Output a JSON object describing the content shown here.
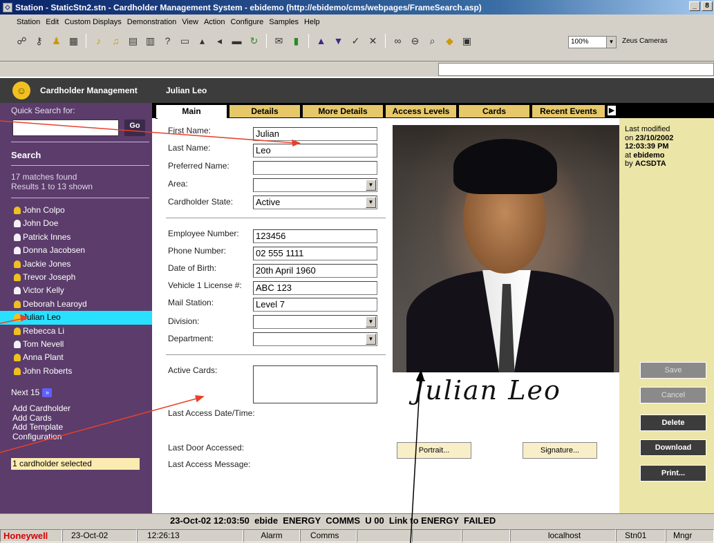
{
  "window": {
    "title": "Station - StaticStn2.stn - Cardholder Management System - ebidemo (http://ebidemo/cms/webpages/FrameSearch.asp)",
    "controls": [
      "_",
      "8",
      "×"
    ]
  },
  "menu": [
    "Station",
    "Edit",
    "Custom Displays",
    "Demonstration",
    "View",
    "Action",
    "Configure",
    "Samples",
    "Help"
  ],
  "toolbar": {
    "zoom": "100%",
    "camera": "Zeus Cameras"
  },
  "header": {
    "section": "Cardholder Management",
    "person": "Julian Leo"
  },
  "sidebar": {
    "quick_search_label": "Quick Search for:",
    "go_label": "Go",
    "search_heading": "Search",
    "matches": "17 matches found",
    "shown": "Results 1 to 13 shown",
    "results": [
      {
        "name": "John Colpo",
        "icon": "yellow"
      },
      {
        "name": "John Doe",
        "icon": "white"
      },
      {
        "name": "Patrick Innes",
        "icon": "white"
      },
      {
        "name": "Donna Jacobsen",
        "icon": "white"
      },
      {
        "name": "Jackie Jones",
        "icon": "yellow"
      },
      {
        "name": "Trevor Joseph",
        "icon": "yellow"
      },
      {
        "name": "Victor Kelly",
        "icon": "white"
      },
      {
        "name": "Deborah Learoyd",
        "icon": "yellow"
      },
      {
        "name": "Julian Leo",
        "icon": "yellow",
        "selected": true
      },
      {
        "name": "Rebecca Li",
        "icon": "yellow"
      },
      {
        "name": "Tom Nevell",
        "icon": "white"
      },
      {
        "name": "Anna Plant",
        "icon": "yellow"
      },
      {
        "name": "John Roberts",
        "icon": "yellow"
      }
    ],
    "next_label": "Next 15",
    "links": [
      "Add Cardholder",
      "Add Cards",
      "Add Template",
      "Configuration"
    ],
    "selected_status": "1 cardholder selected"
  },
  "tabs": [
    "Main",
    "Details",
    "More Details",
    "Access Levels",
    "Cards",
    "Recent Events"
  ],
  "form": {
    "first_name": {
      "label": "First Name:",
      "value": "Julian"
    },
    "last_name": {
      "label": "Last Name:",
      "value": "Leo"
    },
    "preferred_name": {
      "label": "Preferred Name:",
      "value": ""
    },
    "area": {
      "label": "Area:",
      "value": ""
    },
    "state": {
      "label": "Cardholder State:",
      "value": "Active"
    },
    "employee_number": {
      "label": "Employee Number:",
      "value": "123456"
    },
    "phone": {
      "label": "Phone Number:",
      "value": "02 555 1111"
    },
    "dob": {
      "label": "Date of Birth:",
      "value": "20th April 1960"
    },
    "vehicle": {
      "label": "Vehicle 1 License #:",
      "value": "ABC 123"
    },
    "mail_station": {
      "label": "Mail Station:",
      "value": "Level 7"
    },
    "division": {
      "label": "Division:",
      "value": ""
    },
    "department": {
      "label": "Department:",
      "value": ""
    },
    "active_cards": {
      "label": "Active Cards:"
    },
    "last_access_time": {
      "label": "Last Access Date/Time:"
    },
    "last_door": {
      "label": "Last Door Accessed:"
    },
    "last_message": {
      "label": "Last Access Message:"
    },
    "signature_text": "Julian Leo",
    "portrait_btn": "Portrait...",
    "signature_btn": "Signature..."
  },
  "right_panel": {
    "line1": "Last modified",
    "line2_prefix": "on ",
    "line2_date": "23/10/2002",
    "line3": "12:03:39 PM",
    "line4_prefix": "at ",
    "line4_value": "ebidemo",
    "line5_prefix": "by ",
    "line5_value": "ACSDTA",
    "buttons": {
      "save": "Save",
      "cancel": "Cancel",
      "delete": "Delete",
      "download": "Download",
      "print": "Print..."
    }
  },
  "status": {
    "message": "23-Oct-02 12:03:50  ebide  ENERGY  COMMS  U 00  Link to ENERGY  FAILED"
  },
  "taskbar": {
    "brand": "Honeywell",
    "date": "23-Oct-02",
    "time": "12:26:13",
    "alarm": "Alarm",
    "comms": "Comms",
    "host": "localhost",
    "station": "Stn01",
    "user": "Mngr"
  },
  "colors": {
    "sidebar": "#5b3c6b",
    "tab": "#e6c86a",
    "panel": "#ece5a8",
    "selection": "#2ae0ff",
    "brand": "#d40000"
  }
}
